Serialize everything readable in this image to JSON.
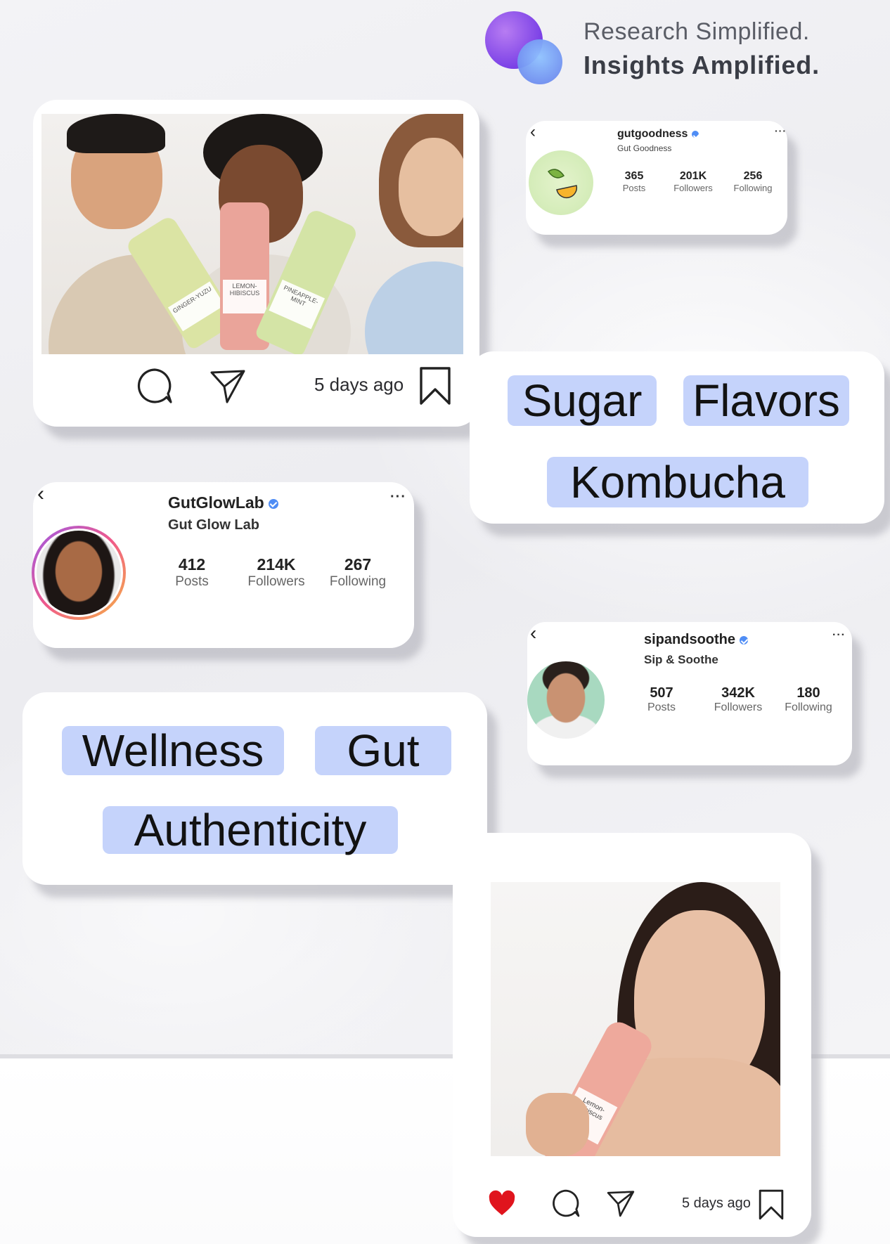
{
  "brand": {
    "line1": "Research Simplified.",
    "line2": "Insights Amplified."
  },
  "post_top": {
    "bottle_labels": [
      "GINGER-YUZU",
      "LEMON-HIBISCUS",
      "PINEAPPLE-MINT"
    ],
    "timestamp": "5 days ago"
  },
  "profile_gutgoodness": {
    "handle": "gutgoodness",
    "name": "Gut Goodness",
    "posts": "365",
    "posts_label": "Posts",
    "followers": "201K",
    "followers_label": "Followers",
    "following": "256",
    "following_label": "Following"
  },
  "tags_top": [
    "Sugar",
    "Flavors",
    "Kombucha"
  ],
  "profile_gutglowlab": {
    "handle": "GutGlowLab",
    "name": "Gut Glow Lab",
    "posts": "412",
    "posts_label": "Posts",
    "followers": "214K",
    "followers_label": "Followers",
    "following": "267",
    "following_label": "Following"
  },
  "profile_sipandsoothe": {
    "handle": "sipandsoothe",
    "name": "Sip & Soothe",
    "posts": "507",
    "posts_label": "Posts",
    "followers": "342K",
    "followers_label": "Followers",
    "following": "180",
    "following_label": "Following"
  },
  "tags_bottom": [
    "Wellness",
    "Gut",
    "Authenticity"
  ],
  "post_bottom": {
    "bottle_label": "Lemon-Hibiscus",
    "timestamp": "5 days ago"
  },
  "colors": {
    "chip": "#c5d3fb",
    "verified": "#4f8df5",
    "like": "#e0141d",
    "brand_purple": "#7a40e6",
    "brand_blue": "#6f8ff0"
  },
  "icons": [
    "comment-icon",
    "send-icon",
    "bookmark-icon",
    "heart-icon",
    "chevron-left-icon",
    "more-icon",
    "verified-badge-icon"
  ]
}
